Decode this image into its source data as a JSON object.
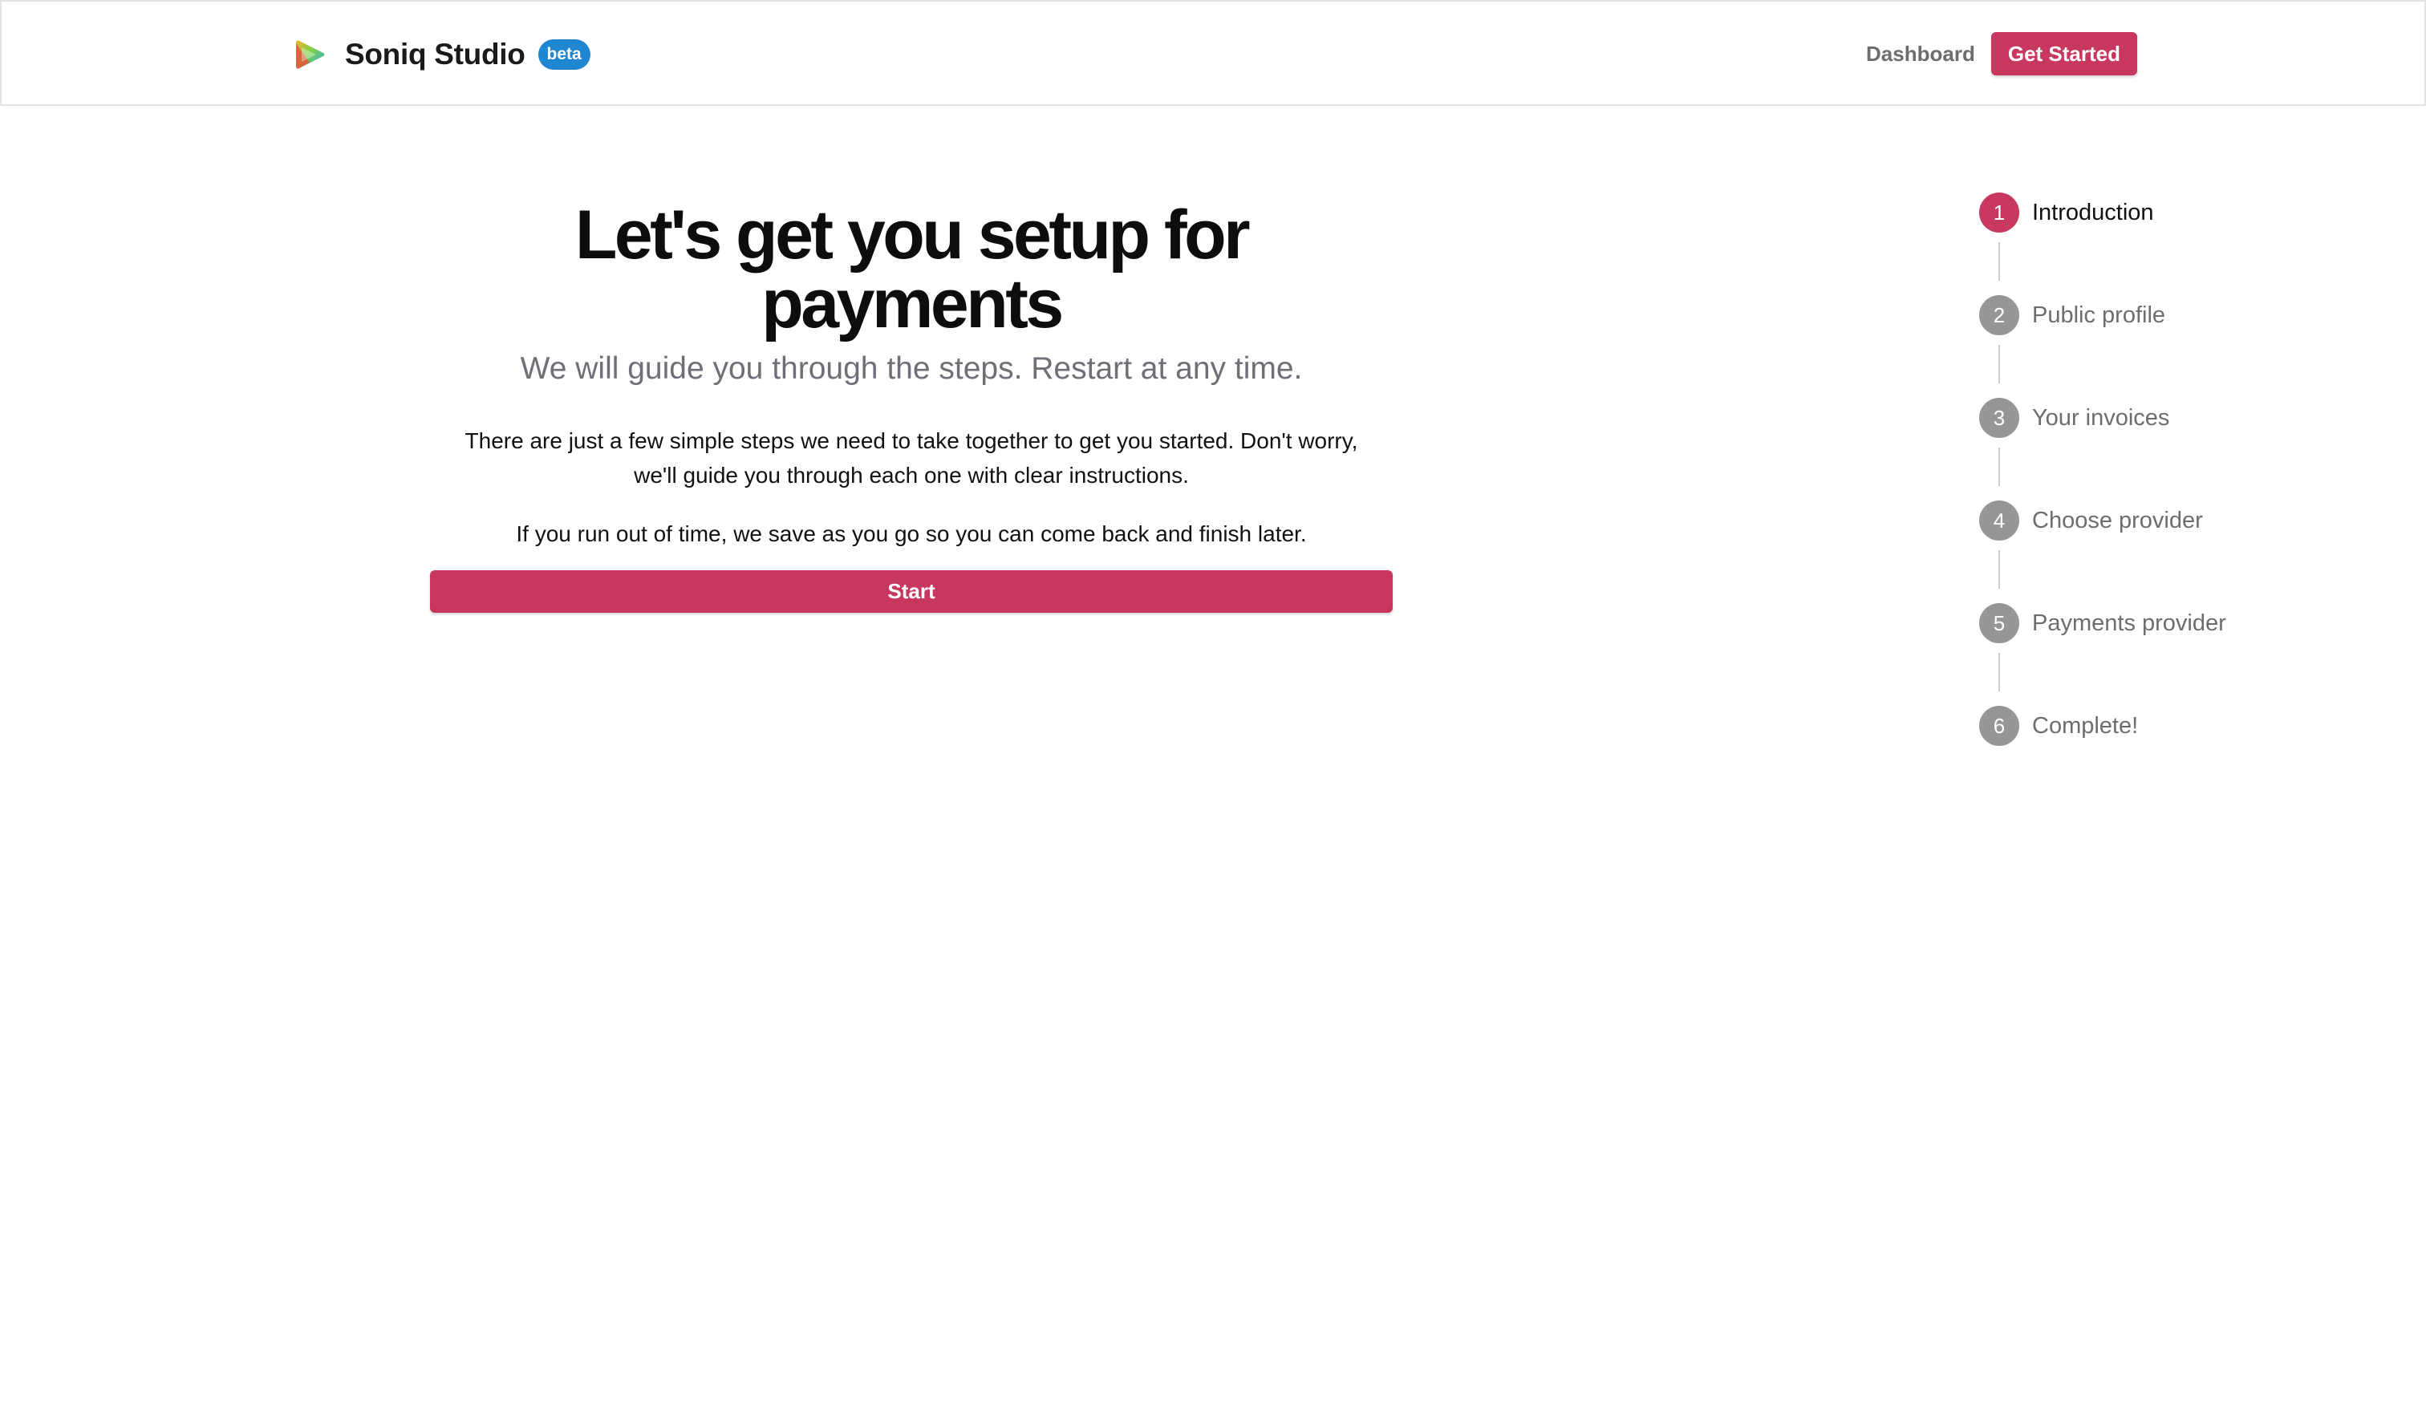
{
  "header": {
    "brand_name": "Soniq Studio",
    "beta_label": "beta",
    "nav_dashboard": "Dashboard",
    "nav_get_started": "Get Started"
  },
  "main": {
    "headline": "Let's get you setup for payments",
    "subheading": "We will guide you through the steps. Restart at any time.",
    "paragraph_1": "There are just a few simple steps we need to take together to get you started. Don't worry, we'll guide you through each one with clear instructions.",
    "paragraph_2": "If you run out of time, we save as you go so you can come back and finish later.",
    "start_button": "Start"
  },
  "steps": [
    {
      "number": "1",
      "label": "Introduction",
      "active": true
    },
    {
      "number": "2",
      "label": "Public profile",
      "active": false
    },
    {
      "number": "3",
      "label": "Your invoices",
      "active": false
    },
    {
      "number": "4",
      "label": "Choose provider",
      "active": false
    },
    {
      "number": "5",
      "label": "Payments provider",
      "active": false
    },
    {
      "number": "6",
      "label": "Complete!",
      "active": false
    }
  ],
  "colors": {
    "accent": "#c8375e",
    "beta_badge": "#1f86d2",
    "inactive_step": "#969696",
    "muted_text": "#6f6f78"
  },
  "icons": {
    "brand": "play-logo-icon"
  }
}
